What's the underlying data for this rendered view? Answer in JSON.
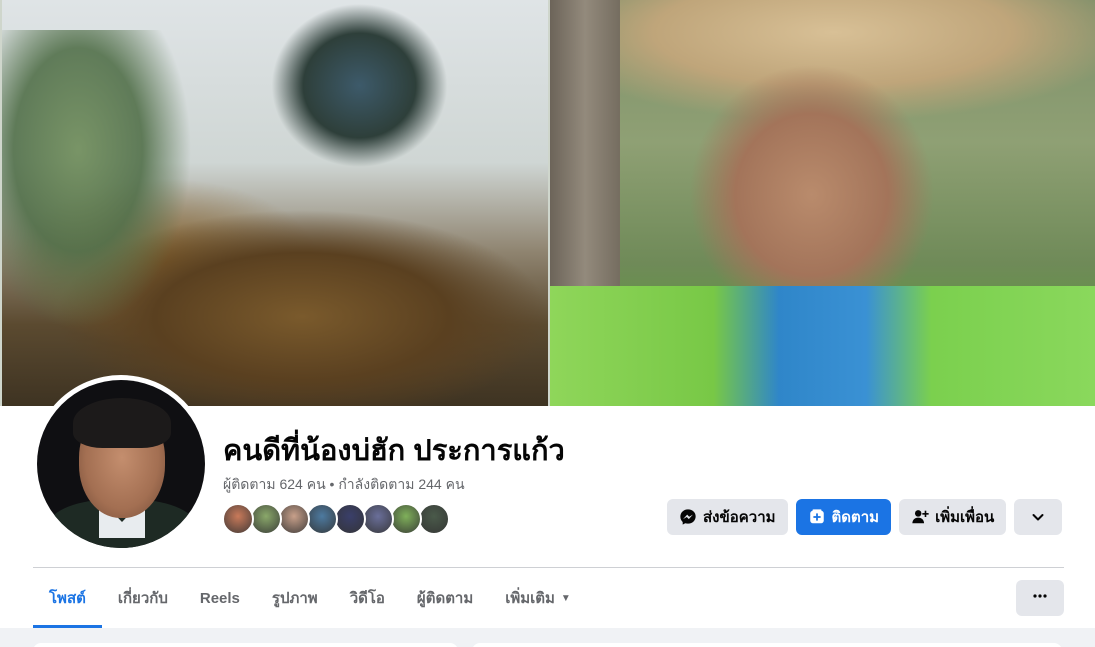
{
  "profile": {
    "name": "คนดีที่น้องบ่ฮัก ประการแก้ว",
    "stats": "ผู้ติดตาม 624 คน • กำลังติดตาม 244 คน"
  },
  "friends": {
    "colors": [
      "#c97a5a",
      "#8aa86a",
      "#c8a08a",
      "#4d7aa0",
      "#3a3f6a",
      "#6a6f9a",
      "#7fb05a",
      "#4a5a4a"
    ]
  },
  "actions": {
    "message_label": "ส่งข้อความ",
    "follow_label": "ติดตาม",
    "add_friend_label": "เพิ่มเพื่อน"
  },
  "tabs": [
    {
      "label": "โพสต์",
      "active": true
    },
    {
      "label": "เกี่ยวกับ"
    },
    {
      "label": "Reels"
    },
    {
      "label": "รูปภาพ"
    },
    {
      "label": "วิดีโอ"
    },
    {
      "label": "ผู้ติดตาม"
    },
    {
      "label": "เพิ่มเติม"
    }
  ],
  "colors": {
    "accent": "#1b74e4",
    "button_gray": "#e4e6eb",
    "secondary_text": "#65676b"
  },
  "icons": {
    "message": "messenger-icon",
    "follow": "follow-plus-icon",
    "add_friend": "add-friend-icon",
    "dropdown": "chevron-down-icon",
    "tab_more": "more-horizontal-icon"
  }
}
